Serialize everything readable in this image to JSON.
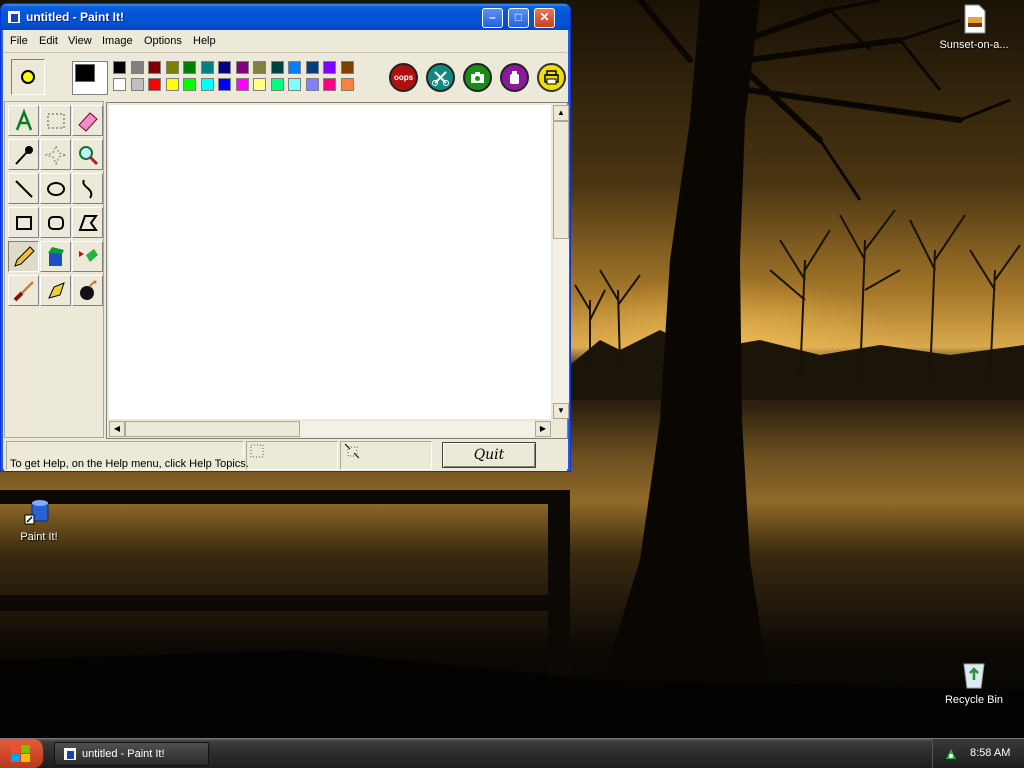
{
  "window": {
    "title": "untitled - Paint It!",
    "buttons": {
      "minimize": "–",
      "maximize": "□",
      "close": "✕"
    }
  },
  "menu": [
    "File",
    "Edit",
    "View",
    "Image",
    "Options",
    "Help"
  ],
  "toolbar": {
    "current_color": "#ffff00",
    "palette_top": [
      "#000000",
      "#808080",
      "#800000",
      "#808000",
      "#008000",
      "#008080",
      "#000080",
      "#800080",
      "#808040",
      "#004040",
      "#0080ff",
      "#004080",
      "#8000ff",
      "#804000"
    ],
    "palette_bottom": [
      "#ffffff",
      "#c0c0c0",
      "#ff0000",
      "#ffff00",
      "#00ff00",
      "#00ffff",
      "#0000ff",
      "#ff00ff",
      "#ffff80",
      "#00ff80",
      "#80ffff",
      "#8080ff",
      "#ff0080",
      "#ff8040"
    ],
    "oops_label": "oops",
    "round_buttons": [
      {
        "name": "oops-button",
        "color": "#b01010"
      },
      {
        "name": "scissors-button",
        "color": "#0f8a80"
      },
      {
        "name": "camera-button",
        "color": "#1a8a1a"
      },
      {
        "name": "jar-button",
        "color": "#8a1a9a"
      },
      {
        "name": "print-button",
        "color": "#f0e000"
      }
    ]
  },
  "tools": [
    "text-tool",
    "select-rectangle-tool",
    "eraser-tool",
    "eyedropper-tool",
    "select-free-tool",
    "zoom-tool",
    "line-tool",
    "ellipse-tool",
    "curve-tool",
    "rectangle-tool",
    "rounded-rectangle-tool",
    "polygon-tool",
    "pencil-tool",
    "paint-bucket-tool",
    "spray-tool",
    "brush-tool",
    "stamp-tool",
    "bomb-tool"
  ],
  "active_tool": "pencil-tool",
  "status": {
    "help_text": "To get Help, on the Help menu, click Help Topics.",
    "quit_label": "Quit"
  },
  "desktop_icons": {
    "sunset_file": "Sunset-on-a...",
    "paint_it": "Paint It!",
    "recycle_bin": "Recycle Bin"
  },
  "taskbar": {
    "task_label": "untitled - Paint It!",
    "clock": "8:58 AM"
  }
}
